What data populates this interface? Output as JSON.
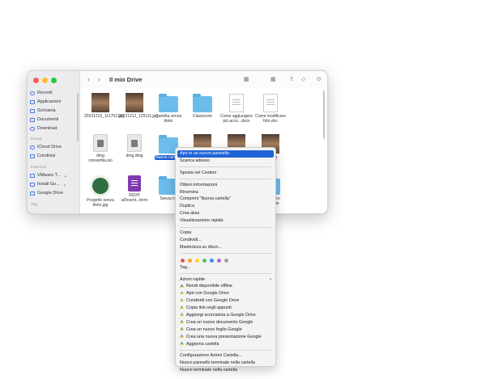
{
  "window": {
    "title": "Il mio Drive"
  },
  "sidebar": {
    "favorites": [
      "Recenti",
      "Applicazioni",
      "Scrivania",
      "Documenti",
      "Download"
    ],
    "icloud_section": "iCloud",
    "icloud": [
      "iCloud Drive",
      "Condivisi"
    ],
    "locations_section": "Posizioni",
    "locations": [
      "VMware T...",
      "Install Go...",
      "Google Drive"
    ],
    "tags_section": "Tag"
  },
  "files": {
    "row1": [
      "20221212_111752.jpg",
      "20221212_125111.jpg",
      "Cartella senza titolo",
      "Classroom",
      "Come aggiungere più acco...docx",
      "Come modificare foto.doc"
    ],
    "row2": [
      "dmg convertita.iso",
      "dmg.dmg",
      "Nuova cartella",
      "",
      "",
      "589.jpg"
    ],
    "row3": [
      "Progetto senza titolo.jpg",
      "RSVP all'event...form",
      "Senza no",
      "",
      "",
      "...al centro ...celuche"
    ]
  },
  "context_menu": {
    "group1": [
      "Apri in un nuovo pannello",
      "Scarica adesso"
    ],
    "group2": [
      "Sposta nel Cestino"
    ],
    "group3": [
      "Ottieni informazioni",
      "Rinomina",
      "Comprimi \"Nuova cartella\"",
      "Duplica",
      "Crea alias",
      "Visualizzazione rapida"
    ],
    "group4": [
      "Copia",
      "Condividi...",
      "Masterizza su disco..."
    ],
    "tag_colors": [
      "#ef5753",
      "#f5a623",
      "#f7d330",
      "#5ac05a",
      "#3d8fe8",
      "#a46bd6",
      "#a0a0a0"
    ],
    "tags_label": "Tag...",
    "quick_actions": "Azioni rapide",
    "drive_actions": [
      "Rendi disponibile offline",
      "Apri con Google Drive",
      "Condividi con Google Drive",
      "Copia link negli appunti",
      "Aggiungi scorciatoia a Google Drive",
      "Crea un nuovo documento Google",
      "Crea un nuovo foglio Google",
      "Crea una nuova presentazione Google",
      "Aggiorna cartella"
    ],
    "group_last": [
      "Configurazione Azioni Cartella...",
      "Nuovo pannello terminale nella cartella",
      "Nuovo terminale nella cartella"
    ]
  }
}
